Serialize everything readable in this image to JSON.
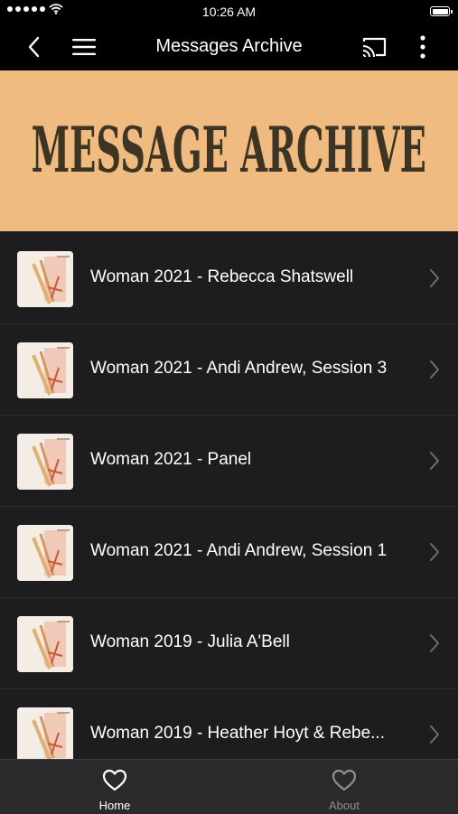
{
  "status_bar": {
    "time": "10:26 AM",
    "signal_icon": "signal-dots-icon",
    "wifi_icon": "wifi-icon",
    "battery_icon": "battery-icon"
  },
  "navbar": {
    "title": "Messages Archive"
  },
  "banner": {
    "text": "MESSAGE ARCHIVE",
    "background": "#f0bb80",
    "text_color": "#3d3424"
  },
  "list": {
    "items": [
      {
        "label": "Woman 2021 - Rebecca Shatswell"
      },
      {
        "label": "Woman 2021 - Andi Andrew, Session 3"
      },
      {
        "label": "Woman 2021 - Panel"
      },
      {
        "label": "Woman 2021 - Andi Andrew, Session 1"
      },
      {
        "label": "Woman 2019 - Julia A'Bell"
      },
      {
        "label": "Woman 2019 -  Heather Hoyt & Rebe..."
      }
    ]
  },
  "tabbar": {
    "tabs": [
      {
        "label": "Home",
        "active": true
      },
      {
        "label": "About",
        "active": false
      }
    ]
  },
  "colors": {
    "background": "#1d1d1f",
    "bar": "#000000",
    "tabbar": "#2a2a2c"
  }
}
